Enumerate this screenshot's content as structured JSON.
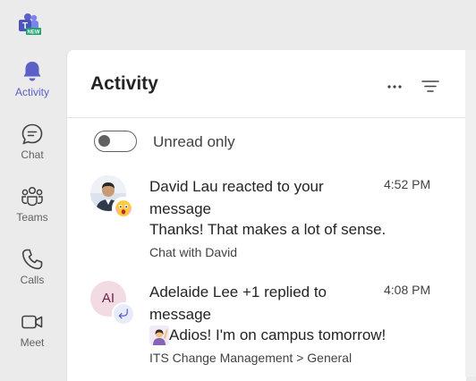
{
  "app": {
    "logo_badge": "NEW",
    "brand_color": "#5b5fc7"
  },
  "rail": {
    "items": [
      {
        "label": "Activity",
        "icon": "bell-icon",
        "active": true
      },
      {
        "label": "Chat",
        "icon": "chat-icon",
        "active": false
      },
      {
        "label": "Teams",
        "icon": "teams-icon",
        "active": false
      },
      {
        "label": "Calls",
        "icon": "phone-icon",
        "active": false
      },
      {
        "label": "Meet",
        "icon": "video-icon",
        "active": false
      }
    ]
  },
  "panel": {
    "title": "Activity",
    "more_icon": "more-horizontal-icon",
    "filter_icon": "filter-icon",
    "toggle": {
      "label": "Unread only",
      "on": false
    }
  },
  "feed": [
    {
      "title": "David Lau reacted to your message",
      "time": "4:52 PM",
      "message": "Thanks! That makes a lot of sense.",
      "context": "Chat with David",
      "avatar": "photo",
      "badge_icon": "surprised-emoji-icon"
    },
    {
      "title": "Adelaide Lee +1 replied to message",
      "time": "4:08 PM",
      "message": "Adios! I'm on campus tomorrow!",
      "context": "ITS Change Management > General",
      "avatar_initials": "AI",
      "badge_icon": "reply-arrow-icon"
    }
  ]
}
